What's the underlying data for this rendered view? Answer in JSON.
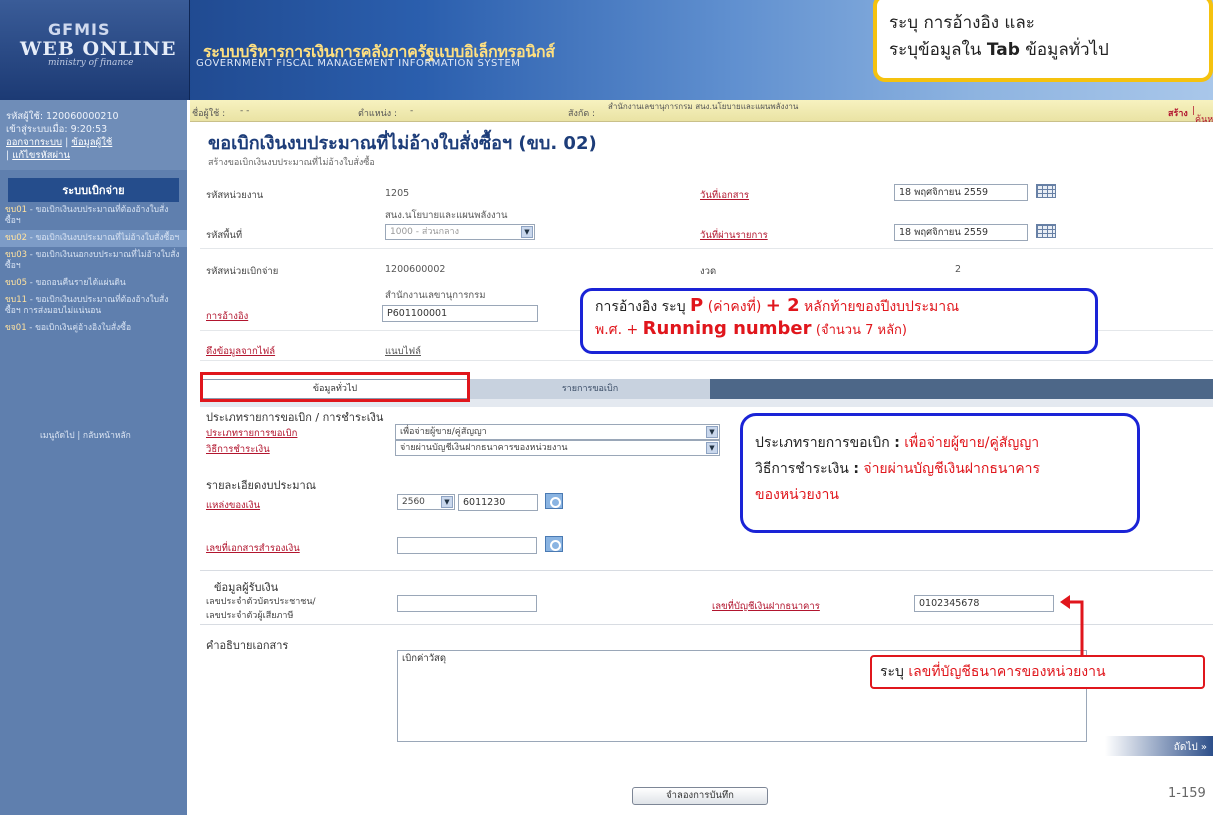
{
  "header": {
    "logo_text1": "GFMIS",
    "logo_text2": "WEB ONLINE",
    "logo_text3": "ministry of finance",
    "system_name_th": "ระบบบริหารการเงินการคลังภาครัฐแบบอิเล็กทรอนิกส์",
    "system_name_en": "GOVERNMENT FISCAL MANAGEMENT INFORMATION SYSTEM"
  },
  "sidebar": {
    "user_id": "รหัสผู้ใช้: 120060000210",
    "login_time": "เข้าสู่ระบบเมื่อ: 9:20:53",
    "logout_link": "ออกจากระบบ",
    "user_info_link": "ข้อมูลผู้ใช้",
    "change_password_link": "แก้ไขรหัสผ่าน",
    "menu_title": "ระบบเบิกจ่าย",
    "items": [
      {
        "code": "ขบ01",
        "label": "ขอเบิกเงินงบประมาณที่ต้องอ้างใบสั่งซื้อฯ"
      },
      {
        "code": "ขบ02",
        "label": "ขอเบิกเงินงบประมาณที่ไม่อ้างใบสั่งซื้อฯ"
      },
      {
        "code": "ขบ03",
        "label": "ขอเบิกเงินนอกงบประมาณที่ไม่อ้างใบสั่งซื้อฯ"
      },
      {
        "code": "ขบ05",
        "label": "ขอถอนคืนรายได้แผ่นดิน"
      },
      {
        "code": "ขบ11",
        "label": "ขอเบิกเงินงบประมาณที่ต้องอ้างใบสั่งซื้อฯ การส่งมอบไม่แน่นอน"
      },
      {
        "code": "ขจ01",
        "label": "ขอเบิกเงินคู่อ้างอิงใบสั่งซื้อ"
      }
    ],
    "footer": "เมนูถัดไป | กลับหน้าหลัก"
  },
  "topbar": {
    "user_label": "ชื่อผู้ใช้ :",
    "user_value": "- -",
    "position_label": "ตำแหน่ง :",
    "position_value": "-",
    "agency_label": "สังกัด :",
    "agency_value": "สำนักงานเลขานุการกรม สนง.นโยบายและแผนพลังงาน",
    "action_create": "สร้าง",
    "action_search": "ค้นหา"
  },
  "page": {
    "title": "ขอเบิกเงินงบประมาณที่ไม่อ้างใบสั่งซื้อฯ (ขบ. 02)",
    "subtitle": "สร้างขอเบิกเงินงบประมาณที่ไม่อ้างใบสั่งซื้อ"
  },
  "form": {
    "agency_code_label": "รหัสหน่วยงาน",
    "agency_code_value": "1205",
    "agency_name_value": "สนง.นโยบายและแผนพลังงาน",
    "area_code_label": "รหัสพื้นที่",
    "area_code_value": "1000 - ส่วนกลาง",
    "disburse_unit_label": "รหัสหน่วยเบิกจ่าย",
    "disburse_unit_value": "1200600002",
    "disburse_unit_name": "สำนักงานเลขานุการกรม",
    "reference_label": "การอ้างอิง",
    "reference_value": "P601100001",
    "file_label": "ดึงข้อมูลจากไฟล์",
    "file_value": "แนบไฟล์",
    "doc_date_label": "วันที่เอกสาร",
    "doc_date_value": "18 พฤศจิกายน 2559",
    "post_date_label": "วันที่ผ่านรายการ",
    "post_date_value": "18 พฤศจิกายน 2559",
    "period_label": "งวด",
    "period_value": "2"
  },
  "tabs": {
    "general": "ข้อมูลทั่วไป",
    "items": "รายการขอเบิก"
  },
  "general_tab": {
    "section_type": "ประเภทรายการขอเบิก / การชำระเงิน",
    "request_type_label": "ประเภทรายการขอเบิก",
    "request_type_value": "เพื่อจ่ายผู้ขาย/คู่สัญญา",
    "payment_method_label": "วิธีการชำระเงิน",
    "payment_method_value": "จ่ายผ่านบัญชีเงินฝากธนาคารของหน่วยงาน",
    "section_budget": "รายละเอียดงบประมาณ",
    "fund_source_label": "แหล่งของเงิน",
    "fund_year_value": "2560",
    "fund_source_value": "6011230",
    "reserve_doc_label": "เลขที่เอกสารสำรองเงิน",
    "reserve_doc_value": "",
    "section_payee": "ข้อมูลผู้รับเงิน",
    "citizen_id_label1": "เลขประจำตัวบัตรประชาชน/",
    "citizen_id_label2": "เลขประจำตัวผู้เสียภาษี",
    "citizen_id_value": "",
    "bank_account_label": "เลขที่บัญชีเงินฝากธนาคาร",
    "bank_account_value": "0102345678",
    "section_desc": "คำอธิบายเอกสาร",
    "desc_value": "เบิกค่าวัสดุ"
  },
  "buttons": {
    "next": "ถัดไป »",
    "save_draft": "จำลองการบันทึก"
  },
  "callouts": {
    "top_line1": "ระบุ การอ้างอิง และ",
    "top_line2_a": "ระบุข้อมูลใน ",
    "top_line2_b": "Tab",
    "top_line2_c": " ข้อมูลทั่วไป",
    "ref_a": "การอ้างอิง ระบุ ",
    "ref_p": "P",
    "ref_b": " (ค่าคงที่) ",
    "ref_plus2": "+ 2",
    "ref_c": " หลักท้ายของปีงบประมาณ",
    "ref_d": "พ.ศ. + ",
    "ref_running": "Running number",
    "ref_e": "(จำนวน 7 หลัก)",
    "type_a": "ประเภทรายการขอเบิก ",
    "type_colon": ":",
    "type_b": " เพื่อจ่ายผู้ขาย/คู่สัญญา",
    "pay_a": "วิธีการชำระเงิน ",
    "pay_colon": ":",
    "pay_b": " จ่ายผ่านบัญชีเงินฝากธนาคาร",
    "pay_c": "ของหน่วยงาน",
    "bank_a": "ระบุ ",
    "bank_b": "เลขที่บัญชีธนาคารของหน่วยงาน"
  },
  "page_number": "1-159",
  "colors": {
    "callout_yellow": "#f5c20e",
    "callout_blue": "#1a23d6",
    "callout_red": "#e0161c",
    "title_blue": "#1d3d79"
  }
}
